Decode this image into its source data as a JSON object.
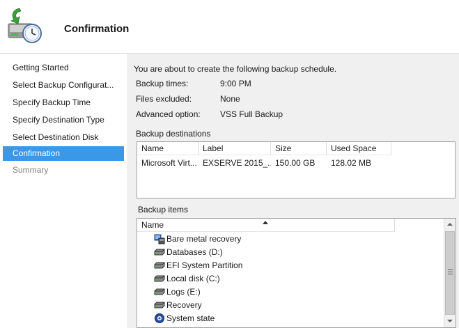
{
  "header": {
    "title": "Confirmation",
    "icon": "backup-schedule-icon"
  },
  "sidebar": {
    "items": [
      {
        "label": "Getting Started",
        "state": "normal"
      },
      {
        "label": "Select Backup Configurat...",
        "state": "normal"
      },
      {
        "label": "Specify Backup Time",
        "state": "normal"
      },
      {
        "label": "Specify Destination Type",
        "state": "normal"
      },
      {
        "label": "Select Destination Disk",
        "state": "normal"
      },
      {
        "label": "Confirmation",
        "state": "active"
      },
      {
        "label": "Summary",
        "state": "disabled"
      }
    ]
  },
  "main": {
    "intro": "You are about to create the following backup schedule.",
    "details": [
      {
        "label": "Backup times:",
        "value": "9:00 PM"
      },
      {
        "label": "Files excluded:",
        "value": "None"
      },
      {
        "label": "Advanced option:",
        "value": "VSS Full Backup"
      }
    ],
    "destinations": {
      "label": "Backup destinations",
      "columns": [
        "Name",
        "Label",
        "Size",
        "Used Space"
      ],
      "rows": [
        [
          "Microsoft Virt...",
          "EXSERVE 2015_...",
          "150.00 GB",
          "128.02 MB"
        ]
      ]
    },
    "items": {
      "label": "Backup items",
      "column": "Name",
      "entries": [
        {
          "label": "Bare metal recovery",
          "icon": "bare-metal-recovery-icon"
        },
        {
          "label": "Databases (D:)",
          "icon": "drive-icon"
        },
        {
          "label": "EFI System Partition",
          "icon": "drive-icon"
        },
        {
          "label": "Local disk (C:)",
          "icon": "drive-icon"
        },
        {
          "label": "Logs (E:)",
          "icon": "drive-icon"
        },
        {
          "label": "Recovery",
          "icon": "drive-icon"
        },
        {
          "label": "System state",
          "icon": "system-state-icon"
        }
      ]
    }
  },
  "colors": {
    "accent": "#3b98e6",
    "disabled_text": "#808080"
  }
}
